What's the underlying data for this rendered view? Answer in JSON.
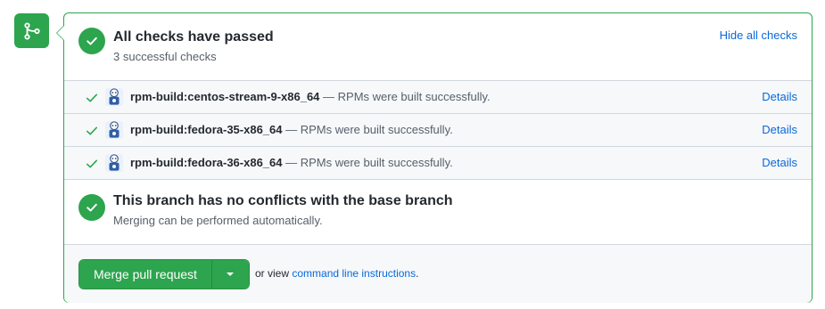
{
  "status": {
    "title": "All checks have passed",
    "subtitle": "3 successful checks",
    "hide_link": "Hide all checks"
  },
  "checks": [
    {
      "name": "rpm-build:centos-stream-9-x86_64",
      "description": "— RPMs were built successfully.",
      "details": "Details"
    },
    {
      "name": "rpm-build:fedora-35-x86_64",
      "description": "— RPMs were built successfully.",
      "details": "Details"
    },
    {
      "name": "rpm-build:fedora-36-x86_64",
      "description": "— RPMs were built successfully.",
      "details": "Details"
    }
  ],
  "conflicts": {
    "title": "This branch has no conflicts with the base branch",
    "subtitle": "Merging can be performed automatically."
  },
  "merge": {
    "button_label": "Merge pull request",
    "or_view": "or view",
    "cli_link": "command line instructions",
    "period": "."
  },
  "icons": {
    "merge": "git-merge-icon",
    "check_circle": "check-circle-icon",
    "tick": "check-icon",
    "avatar": "packit-bot-avatar",
    "dropdown": "triangle-down-icon"
  },
  "colors": {
    "success": "#2da44e",
    "link": "#0969da",
    "muted": "#57606a",
    "border": "#d0d7de",
    "row_bg": "#f6f8fa"
  }
}
